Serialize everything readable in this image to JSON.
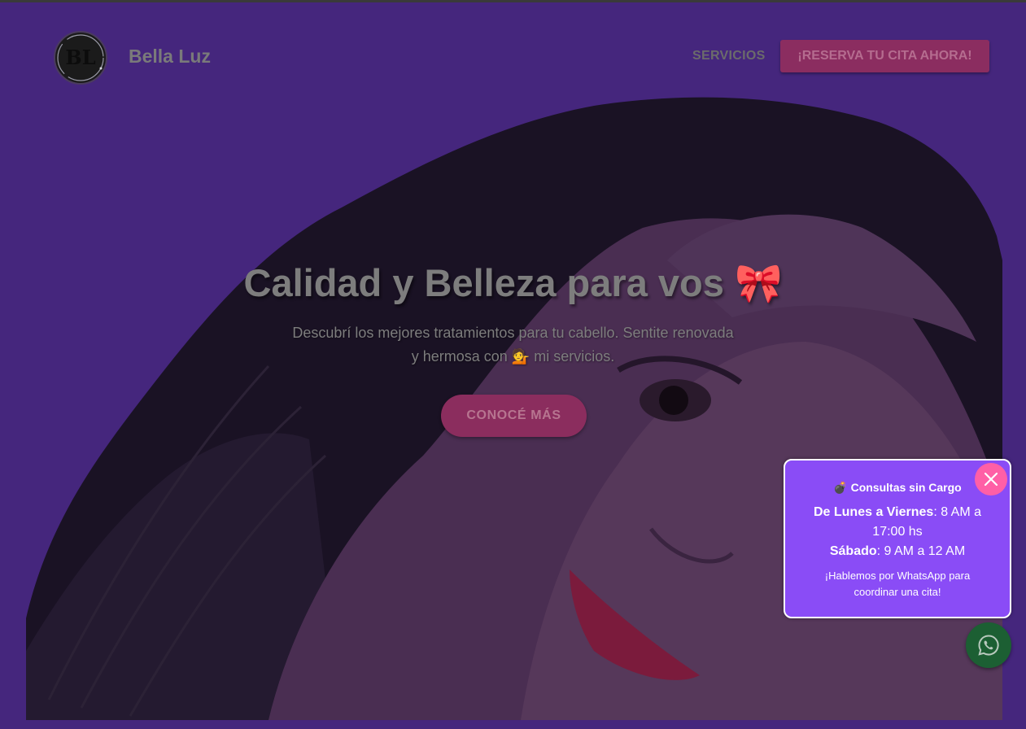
{
  "header": {
    "logo_text": "BL",
    "brand_name": "Bella Luz",
    "nav_servicios": "SERVICIOS",
    "reserve_button": "¡RESERVA TU CITA AHORA!"
  },
  "hero": {
    "title": "Calidad y Belleza para vos",
    "title_emoji": "🎀",
    "subtitle_line1": "Descubrí los mejores tratamientos para tu cabello. Sentite renovada",
    "subtitle_line2_pre": "y hermosa con",
    "subtitle_emoji": "💁",
    "subtitle_line2_post": "mi servicios.",
    "cta": "CONOCÉ MÁS"
  },
  "popup": {
    "title_emoji": "💣",
    "title": "Consultas sin Cargo",
    "weekdays_label": "De Lunes a Viernes",
    "weekdays_hours": ": 8 AM a 17:00 hs",
    "saturday_label": "Sábado",
    "saturday_hours": ": 9 AM a 12 AM",
    "message": "¡Hablemos por WhatsApp para coordinar una cita!",
    "close_symbol": "×"
  },
  "colors": {
    "background": "#45267d",
    "reserve_button": "#8b2d60",
    "cta_button": "#8b2d5e",
    "popup_background": "#8a4cf6",
    "close_button": "#ff5fa6",
    "whatsapp_button": "#1c5f33"
  },
  "icons": {
    "whatsapp": "whatsapp-icon",
    "close": "close-icon"
  }
}
